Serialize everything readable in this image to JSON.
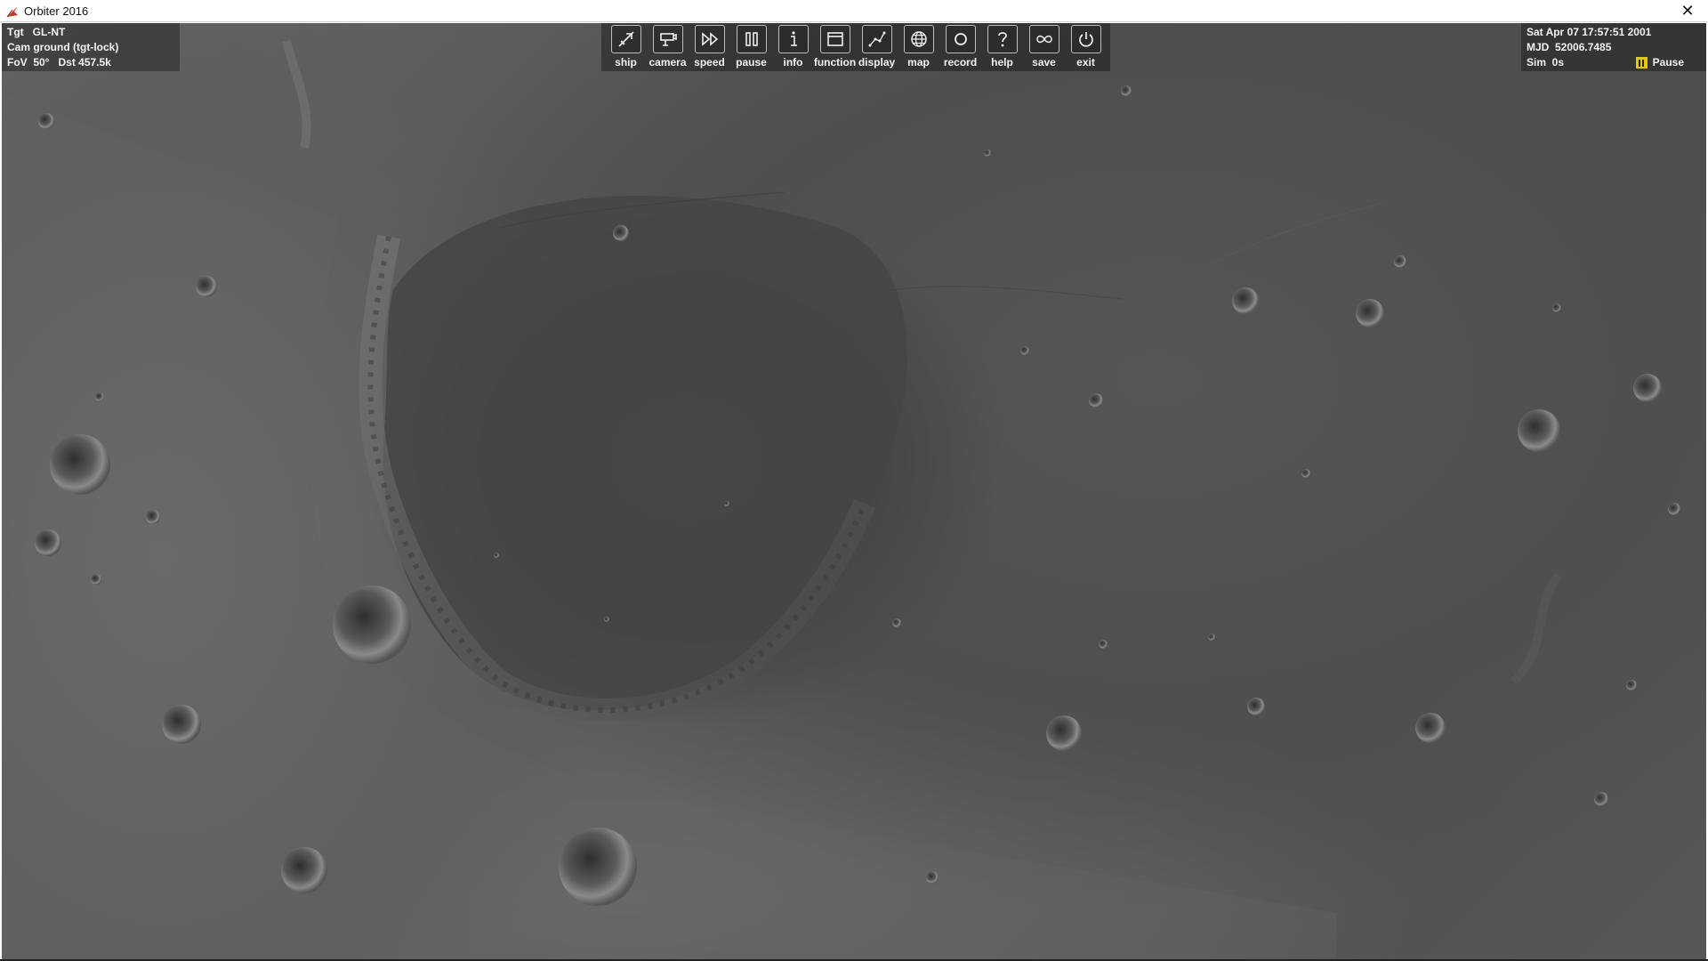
{
  "window": {
    "title": "Orbiter 2016",
    "close_glyph": "✕"
  },
  "hud_left": {
    "line1": "Tgt   GL-NT",
    "line2": "Cam ground (tgt-lock)",
    "line3": "FoV  50°   Dst 457.5k"
  },
  "hud_right": {
    "line1": "Sat Apr 07 17:57:51 2001",
    "line2": "MJD  52006.7485",
    "line3": "Sim  0s",
    "pause_label": "Pause"
  },
  "toolbar": {
    "ship": "ship",
    "camera": "camera",
    "speed": "speed",
    "pause": "pause",
    "info": "info",
    "function": "function",
    "display": "display",
    "map": "map",
    "record": "record",
    "help": "help",
    "save": "save",
    "exit": "exit"
  },
  "colors": {
    "pause_indicator": "#e3c519",
    "hud_text": "#f2f2f2",
    "app_icon": "#c0392b"
  }
}
